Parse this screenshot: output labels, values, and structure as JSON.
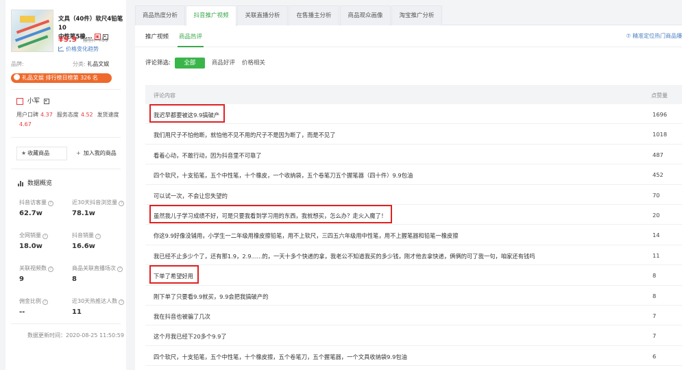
{
  "product": {
    "title_line1": "文具（40件）软尺4铅笔10",
    "title_line2": "中性笔5橡...",
    "price": "¥9.9",
    "original_price": "原价：¥59",
    "trend_label": "价格变化趋势",
    "brand_label": "品牌:",
    "category_label": "分类:",
    "category_value": "礼品文娱",
    "rank_text": "礼品文娱 排行榜日榜第 326 名"
  },
  "shop": {
    "name": "小军",
    "scores_line1": "用户口碑",
    "rep_value": "4.37",
    "service_label": "服务态度",
    "service_value": "4.52",
    "ship_label": "发货速度",
    "ship_value": "4.67"
  },
  "actions": {
    "favorite": "收藏商品",
    "add": "加入我的商品"
  },
  "overview": {
    "title": "数据概览",
    "metrics": [
      {
        "label": "抖音访客量",
        "value": "62.7w"
      },
      {
        "label": "近30天抖音浏览量",
        "value": "78.1w"
      },
      {
        "label": "全网销量",
        "value": "18.0w"
      },
      {
        "label": "抖音销量",
        "value": "16.6w"
      },
      {
        "label": "关联视频数",
        "value": "9"
      },
      {
        "label": "商品关联直播场次",
        "value": "8"
      },
      {
        "label": "佣金比例",
        "value": "--"
      },
      {
        "label": "近30天热推达人数",
        "value": "11"
      }
    ],
    "updated": "数据更新时间：2020-08-25 11:50:59"
  },
  "tabs": [
    "商品热度分析",
    "抖音推广视频",
    "关联直播分析",
    "在售播主分析",
    "商品观众画像",
    "淘宝推广分析"
  ],
  "active_tab": 1,
  "subtabs": [
    "推广视频",
    "商品热评"
  ],
  "active_subtab": 1,
  "hot_link": "⑦ 精准定位热门商品爆",
  "filter": {
    "label": "评论筛选:",
    "options": [
      "全部",
      "商品好评",
      "价格相关"
    ],
    "active": 0
  },
  "table": {
    "col_comment": "评论内容",
    "col_likes": "点赞量",
    "rows": [
      {
        "text": "我迟早都要被这9.9搞破产",
        "likes": "1696",
        "highlight": true
      },
      {
        "text": "我们用尺子不怕他断，就怕他不见不用的尺子不是因为断了，而是不见了",
        "likes": "1018",
        "highlight": false
      },
      {
        "text": "看着心动，不敢行动，因为抖音里不可靠了",
        "likes": "487",
        "highlight": false
      },
      {
        "text": "四个软尺，十支铅笔，五个中性笔，十个橡皮，一个收纳袋，五个卷笔刀五个握笔器（四十件）9.9包油",
        "likes": "452",
        "highlight": false
      },
      {
        "text": "可以试一次，不会让您失望的",
        "likes": "70",
        "highlight": false
      },
      {
        "text": "虽然我儿子学习成绩不好，可是只要我看到学习用的东西，我就想买，怎么办？走火入魔了！",
        "likes": "20",
        "highlight": true
      },
      {
        "text": "你这9.9好像没铺用，小学生一二年级用橡皮擦铅笔，用不上软尺，三四五六年级用中性笔，用不上握笔器和铅笔一橡皮擦",
        "likes": "14",
        "highlight": false
      },
      {
        "text": "我已经不止多少个了，还有那1.9，2.9......的，一天十多个快递的拿，我老公不知道我买的多少钱，刚才他去拿快递，俩俩的可了我一句，咱家还有钱吗",
        "likes": "11",
        "highlight": false
      },
      {
        "text": "下单了希望好用",
        "likes": "8",
        "highlight": true
      },
      {
        "text": "刚下单了只要看9.9就买，9.9会把我搞破产的",
        "likes": "8",
        "highlight": false
      },
      {
        "text": "我在抖音也被骗了几次",
        "likes": "7",
        "highlight": false
      },
      {
        "text": "这个月我已经下20多个9.9了",
        "likes": "7",
        "highlight": false
      },
      {
        "text": "四个软尺，十支铅笔，五个中性笔，十个橡皮擦，五个卷笔刀，五个握笔器，一个文具收纳袋9.9包油",
        "likes": "6",
        "highlight": false
      }
    ]
  },
  "colors": {
    "accent": "#3ba74b",
    "price": "#e4393c",
    "rank_badge": "#ee6a2c",
    "highlight_box": "#e02020"
  }
}
